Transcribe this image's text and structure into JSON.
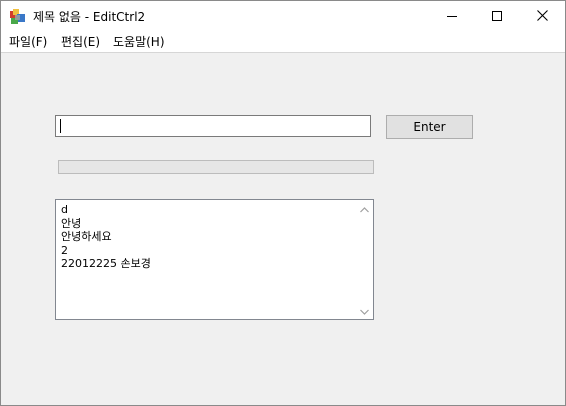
{
  "window": {
    "title": "제목 없음 - EditCtrl2"
  },
  "menu": {
    "items": [
      {
        "label": "파일(F)"
      },
      {
        "label": "편집(E)"
      },
      {
        "label": "도움말(H)"
      }
    ]
  },
  "form": {
    "input_value": "",
    "enter_label": "Enter",
    "progress_fraction": 0
  },
  "list": {
    "lines": [
      "d",
      "안녕",
      "안녕하세요",
      "2",
      "22012225 손보경"
    ]
  },
  "icons": {
    "app": "app-icon",
    "minimize": "minimize-icon",
    "maximize": "maximize-icon",
    "close": "close-icon",
    "scroll_up": "chevron-up-icon",
    "scroll_down": "chevron-down-icon"
  },
  "colors": {
    "client_bg": "#f0f0f0",
    "button_bg": "#e1e1e1",
    "progress_fill": "#06b025"
  }
}
